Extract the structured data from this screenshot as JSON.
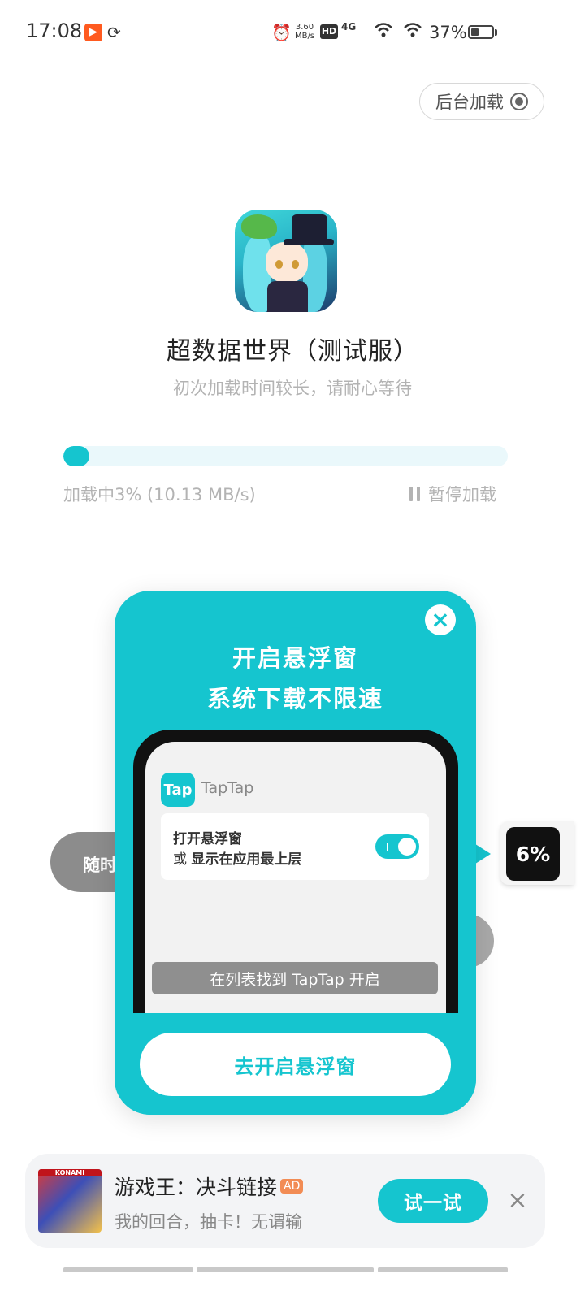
{
  "status_bar": {
    "time": "17:08",
    "speed": "3.60 MB/s",
    "hd": "HD",
    "network": "4G",
    "battery": "37%",
    "battery_level": 0.37
  },
  "header": {
    "background_load_label": "后台加载"
  },
  "game": {
    "title": "超数据世界（测试服）",
    "subtitle": "初次加载时间较长，请耐心等待"
  },
  "progress": {
    "percent": 3,
    "text": "加载中3% (10.13 MB/s)",
    "pause_label": "暂停加载"
  },
  "background_elements": {
    "left_pill_text": "随时"
  },
  "floating_widget": {
    "percent_text": "6%"
  },
  "popup": {
    "title_line1": "开启悬浮窗",
    "title_line2": "系统下载不限速",
    "app_logo_text": "Tap",
    "app_name": "TapTap",
    "setting_line1": "打开悬浮窗",
    "setting_line2_prefix": "或 ",
    "setting_line2_bold": "显示在应用最上层",
    "hint": "在列表找到 TapTap 开启",
    "button_label": "去开启悬浮窗"
  },
  "ad": {
    "image_brand": "KONAMI",
    "title": "游戏王：决斗链接",
    "badge": "AD",
    "subtitle": "我的回合，抽卡！无谓输",
    "button_label": "试一试"
  },
  "colors": {
    "accent": "#15c5cf",
    "progress_track": "#eaf8fb",
    "muted_text": "#b3b3b3"
  }
}
